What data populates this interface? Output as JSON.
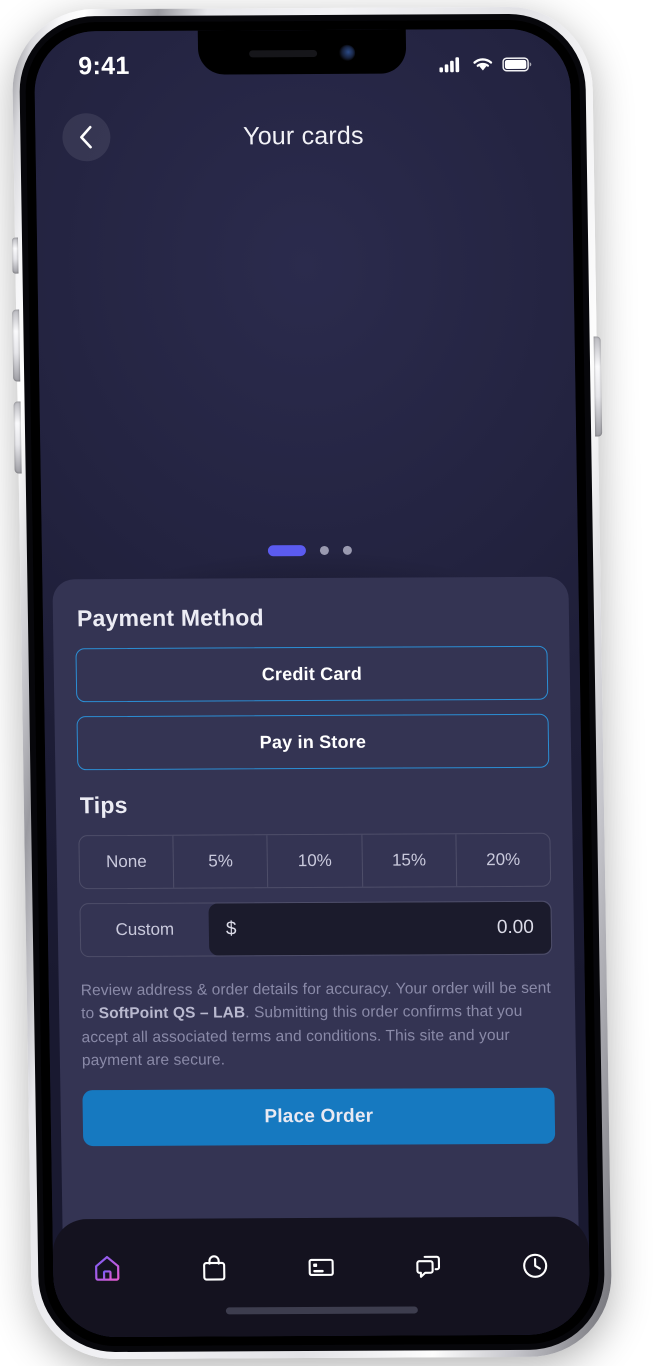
{
  "status_bar": {
    "time": "9:41",
    "icons": [
      "cellular-signal-icon",
      "wifi-icon",
      "battery-icon"
    ]
  },
  "header": {
    "title": "Your cards",
    "back_icon": "chevron-left-icon"
  },
  "carousel": {
    "dot_count": 3,
    "active_index": 0,
    "active_color": "#5B5BF0",
    "inactive_color": "#9A9AB0"
  },
  "sheet": {
    "payment_method": {
      "title": "Payment Method",
      "options": [
        {
          "label": "Credit Card"
        },
        {
          "label": "Pay in Store"
        }
      ],
      "border_color": "#2B8ED4"
    },
    "tips": {
      "title": "Tips",
      "options": [
        {
          "label": "None"
        },
        {
          "label": "5%"
        },
        {
          "label": "10%"
        },
        {
          "label": "15%"
        },
        {
          "label": "20%"
        }
      ],
      "custom": {
        "label": "Custom",
        "currency": "$",
        "value": "0.00"
      }
    },
    "disclaimer": {
      "part1": "Review address & order details for accuracy. Your order will be sent to ",
      "merchant": "SoftPoint QS – LAB",
      "part2": ". Submitting this order confirms that you accept all associated terms and conditions. This site and your payment are secure."
    },
    "place_order": {
      "label": "Place Order",
      "color": "#1679C0"
    }
  },
  "bottom_nav": {
    "items": [
      {
        "icon": "home-icon",
        "active": true
      },
      {
        "icon": "shopping-bag-icon",
        "active": false
      },
      {
        "icon": "card-icon",
        "active": false
      },
      {
        "icon": "chat-icon",
        "active": false
      },
      {
        "icon": "clock-icon",
        "active": false
      }
    ],
    "active_gradient_from": "#7B5CF5",
    "active_gradient_to": "#E35BD0"
  }
}
